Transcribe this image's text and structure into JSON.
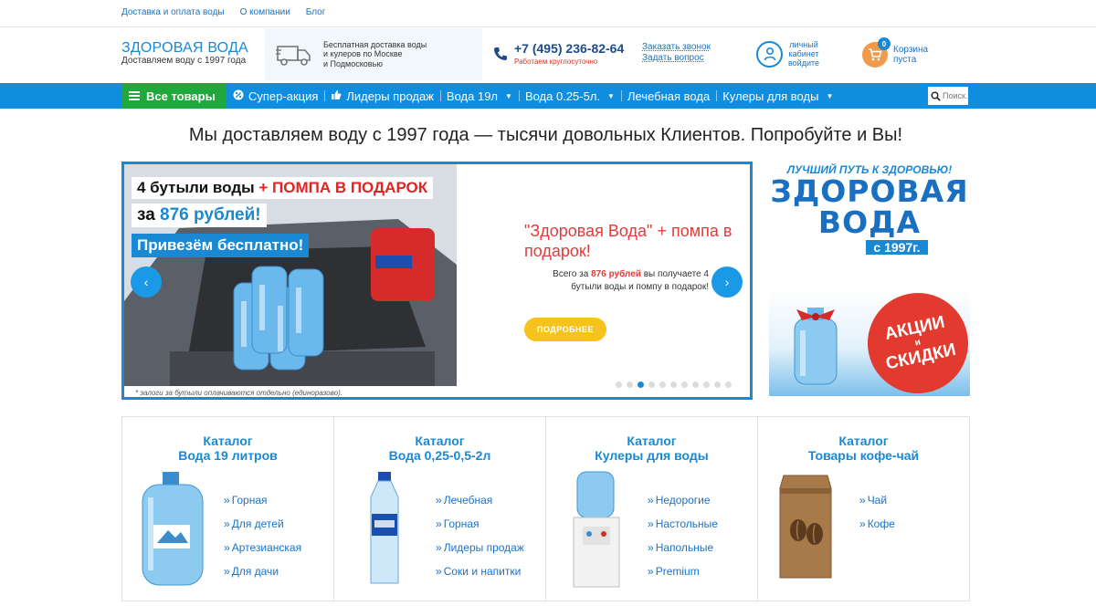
{
  "top_links": [
    "Доставка и оплата воды",
    "О компании",
    "Блог"
  ],
  "logo": {
    "title": "ЗДОРОВАЯ ВОДА",
    "subtitle": "Доставляем воду с 1997 года"
  },
  "delivery": {
    "line1": "Бесплатная доставка воды",
    "line2": "и кулеров по Москве",
    "line3": "и Подмосковью"
  },
  "phone": {
    "number": "+7 (495) 236-82-64",
    "note": "Работаем круглосуточно"
  },
  "call_links": {
    "callback": "Заказать звонок",
    "question": "Задать вопрос"
  },
  "cabinet": {
    "line1": "личный",
    "line2": "кабинет",
    "line3": "войдите"
  },
  "cart": {
    "count": "0",
    "line1": "Корзина",
    "line2": "пуста"
  },
  "nav": {
    "all_goods": "Все товары",
    "items": [
      {
        "label": "Супер-акция",
        "icon": "percent-icon"
      },
      {
        "label": "Лидеры продаж",
        "icon": "thumbs-up-icon"
      },
      {
        "label": "Вода 19л",
        "dropdown": true
      },
      {
        "label": "Вода 0.25-5л.",
        "dropdown": true
      },
      {
        "label": "Лечебная вода"
      },
      {
        "label": "Кулеры для воды",
        "dropdown": true
      }
    ],
    "search_placeholder": "Поиск..."
  },
  "tagline": "Мы доставляем воду с 1997 года — тысячи довольных Клиентов. Попробуйте и Вы!",
  "slider": {
    "img_line1_a": "4 бутыли воды ",
    "img_line1_b": "+ ПОМПА В ПОДАРОК",
    "img_line2_a": "за ",
    "img_line2_b": "876 рублей!",
    "img_line3": "Привезём бесплатно!",
    "note": "* залоги за бутыли оплачиваются отдельно (единоразово).",
    "heading": "\"Здоровая Вода\" + помпа в подарок!",
    "desc_a": "Всего за ",
    "desc_b": "876 рублей",
    "desc_c": " вы получаете 4 бутыли воды и помпу в подарок!",
    "button": "ПОДРОБНЕЕ",
    "dots_total": 11,
    "active_dot": 2
  },
  "brand_banner": {
    "top": "ЛУЧШИЙ ПУТЬ К ЗДОРОВЬЮ!",
    "line1": "ЗДОРОВАЯ",
    "line2": "ВОДА",
    "year": "с 1997г."
  },
  "promo_banner": {
    "line1": "АКЦИИ",
    "line2": "и",
    "line3": "СКИДКИ"
  },
  "catalog": [
    {
      "title1": "Каталог",
      "title2": "Вода 19 литров",
      "image": "water-19l-bottle",
      "links": [
        "Горная",
        "Для детей",
        "Артезианская",
        "Для дачи"
      ]
    },
    {
      "title1": "Каталог",
      "title2": "Вода 0,25-0,5-2л",
      "image": "small-water-bottle",
      "links": [
        "Лечебная",
        "Горная",
        "Лидеры продаж",
        "Соки и напитки"
      ]
    },
    {
      "title1": "Каталог",
      "title2": "Кулеры для воды",
      "image": "water-cooler",
      "links": [
        "Недорогие",
        "Настольные",
        "Напольные",
        "Premium"
      ]
    },
    {
      "title1": "Каталог",
      "title2": "Товары кофе-чай",
      "image": "coffee-bag",
      "links": [
        "Чай",
        "Кофе"
      ]
    }
  ],
  "colors": {
    "brand_blue": "#1a89d4",
    "nav_blue": "#0f8ee0",
    "nav_green": "#1fa83c",
    "accent_red": "#e53a3a",
    "button_yellow": "#f6c21c"
  }
}
